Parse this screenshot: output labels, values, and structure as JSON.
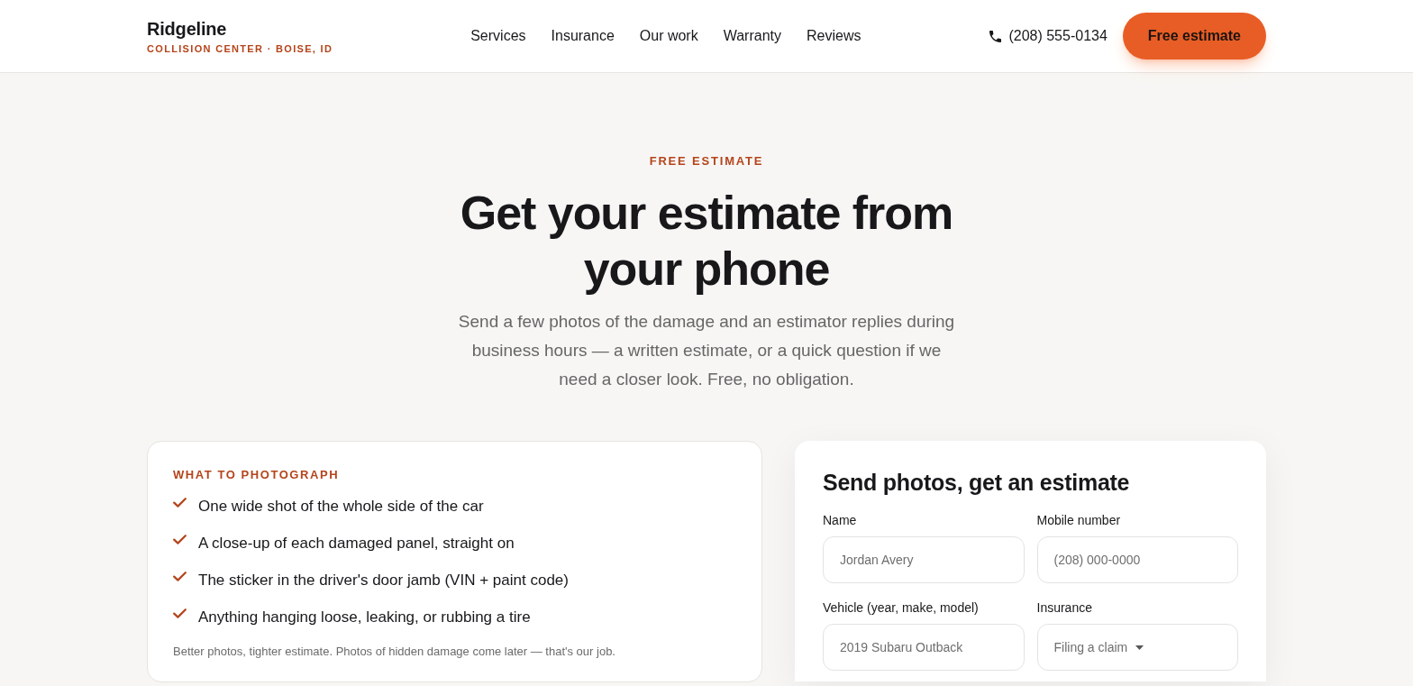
{
  "header": {
    "brand": "Ridgeline",
    "tagline": "COLLISION CENTER · BOISE, ID",
    "nav": [
      "Services",
      "Insurance",
      "Our work",
      "Warranty",
      "Reviews"
    ],
    "phone": "(208) 555-0134",
    "cta": "Free estimate"
  },
  "hero": {
    "eyebrow": "FREE ESTIMATE",
    "title": "Get your estimate from your phone",
    "intro": "Send a few photos of the damage and an estimator replies during business hours — a written estimate, or a quick question if we need a closer look. Free, no obligation."
  },
  "checklist": {
    "heading": "WHAT TO PHOTOGRAPH",
    "items": [
      "One wide shot of the whole side of the car",
      "A close-up of each damaged panel, straight on",
      "The sticker in the driver's door jamb (VIN + paint code)",
      "Anything hanging loose, leaking, or rubbing a tire"
    ],
    "note": "Better photos, tighter estimate. Photos of hidden damage come later — that's our job."
  },
  "form": {
    "title": "Send photos, get an estimate",
    "fields": [
      {
        "kind": "text",
        "label": "Name",
        "placeholder": "Jordan Avery"
      },
      {
        "kind": "text",
        "label": "Mobile number",
        "placeholder": "(208) 000-0000"
      },
      {
        "kind": "text",
        "label": "Vehicle (year, make, model)",
        "placeholder": "2019 Subaru Outback"
      },
      {
        "kind": "select",
        "label": "Insurance",
        "value": "Filing a claim"
      }
    ]
  }
}
